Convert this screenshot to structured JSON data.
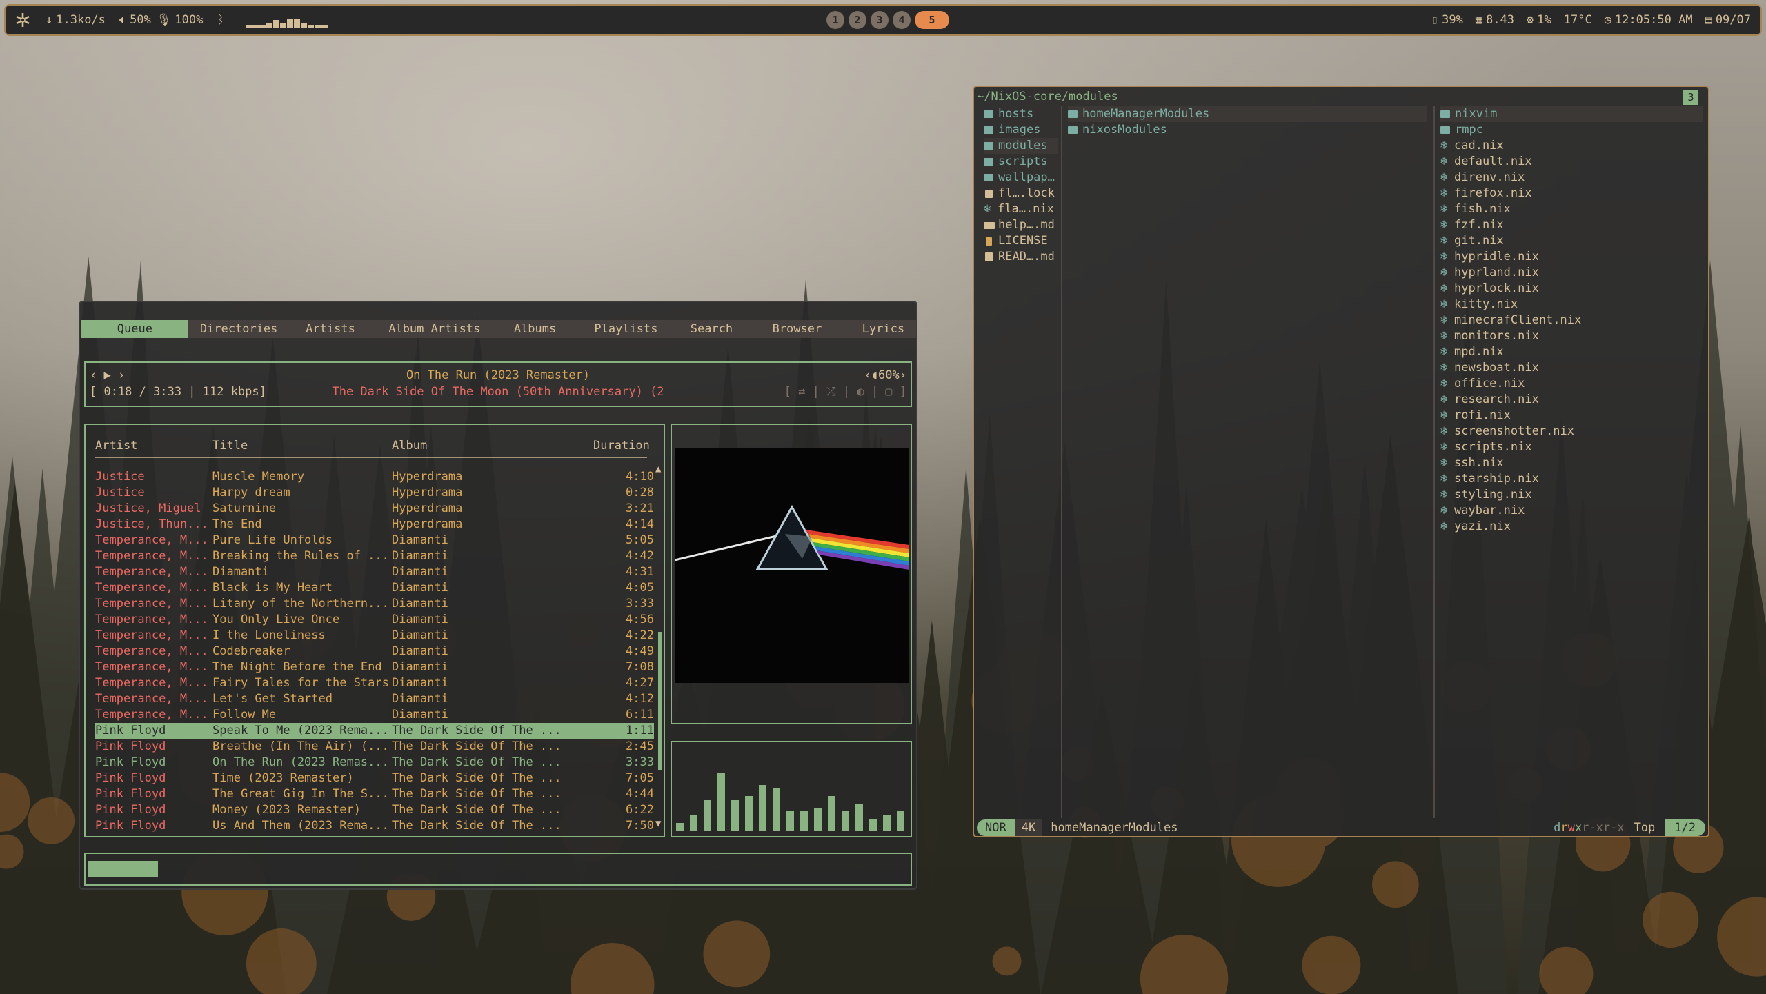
{
  "bar": {
    "net": "1.3ko/s",
    "volume": "50%",
    "mic": "100%",
    "workspaces": [
      "1",
      "2",
      "3",
      "4",
      "5"
    ],
    "active_workspace": "5",
    "battery": "39%",
    "memory": "8.43",
    "cpu": "1%",
    "temp": "17°C",
    "clock": "12:05:50 AM",
    "date": "09/07"
  },
  "ncmpcpp": {
    "tabs": [
      "Queue",
      "Directories",
      "Artists",
      "Album Artists",
      "Albums",
      "Playlists",
      "Search",
      "Browser",
      "Lyrics"
    ],
    "active_tab": "Queue",
    "controls": "‹ ▶ ›",
    "now_title": "On The Run (2023 Remaster)",
    "now_album": "The Dark Side Of The Moon (50th Anniversary) (2",
    "time": "[ 0:18 / 3:33 | 112 kbps]",
    "volume": "‹◖60%›",
    "flags": "[ ⇄ | ⤮ | ◐ | ▢ ]",
    "columns": {
      "artist": "Artist",
      "title": "Title",
      "album": "Album",
      "duration": "Duration"
    },
    "queue": [
      {
        "artist": "Justice",
        "title": "Muscle Memory",
        "album": "Hyperdrama",
        "duration": "4:10"
      },
      {
        "artist": "Justice",
        "title": "Harpy dream",
        "album": "Hyperdrama",
        "duration": "0:28"
      },
      {
        "artist": "Justice, Miguel",
        "title": "Saturnine",
        "album": "Hyperdrama",
        "duration": "3:21"
      },
      {
        "artist": "Justice, Thun...",
        "title": "The End",
        "album": "Hyperdrama",
        "duration": "4:14"
      },
      {
        "artist": "Temperance, M...",
        "title": "Pure Life Unfolds",
        "album": "Diamanti",
        "duration": "5:05"
      },
      {
        "artist": "Temperance, M...",
        "title": "Breaking the Rules of ...",
        "album": "Diamanti",
        "duration": "4:42"
      },
      {
        "artist": "Temperance, M...",
        "title": "Diamanti",
        "album": "Diamanti",
        "duration": "4:31"
      },
      {
        "artist": "Temperance, M...",
        "title": "Black is My Heart",
        "album": "Diamanti",
        "duration": "4:05"
      },
      {
        "artist": "Temperance, M...",
        "title": "Litany of the Northern...",
        "album": "Diamanti",
        "duration": "3:33"
      },
      {
        "artist": "Temperance, M...",
        "title": "You Only Live Once",
        "album": "Diamanti",
        "duration": "4:56"
      },
      {
        "artist": "Temperance, M...",
        "title": "I the Loneliness",
        "album": "Diamanti",
        "duration": "4:22"
      },
      {
        "artist": "Temperance, M...",
        "title": "Codebreaker",
        "album": "Diamanti",
        "duration": "4:49"
      },
      {
        "artist": "Temperance, M...",
        "title": "The Night Before the End",
        "album": "Diamanti",
        "duration": "7:08"
      },
      {
        "artist": "Temperance, M...",
        "title": "Fairy Tales for the Stars",
        "album": "Diamanti",
        "duration": "4:27"
      },
      {
        "artist": "Temperance, M...",
        "title": "Let's Get Started",
        "album": "Diamanti",
        "duration": "4:12"
      },
      {
        "artist": "Temperance, M...",
        "title": "Follow Me",
        "album": "Diamanti",
        "duration": "6:11"
      },
      {
        "artist": "Pink Floyd",
        "title": "Speak To Me (2023 Rema...",
        "album": "The Dark Side Of The ...",
        "duration": "1:11"
      },
      {
        "artist": "Pink Floyd",
        "title": "Breathe (In The Air) (...",
        "album": "The Dark Side Of The ...",
        "duration": "2:45"
      },
      {
        "artist": "Pink Floyd",
        "title": "On The Run (2023 Remas...",
        "album": "The Dark Side Of The ...",
        "duration": "3:33"
      },
      {
        "artist": "Pink Floyd",
        "title": "Time (2023 Remaster)",
        "album": "The Dark Side Of The ...",
        "duration": "7:05"
      },
      {
        "artist": "Pink Floyd",
        "title": "The Great Gig In The S...",
        "album": "The Dark Side Of The ...",
        "duration": "4:44"
      },
      {
        "artist": "Pink Floyd",
        "title": "Money (2023 Remaster)",
        "album": "The Dark Side Of The ...",
        "duration": "6:22"
      },
      {
        "artist": "Pink Floyd",
        "title": "Us And Them (2023 Rema...",
        "album": "The Dark Side Of The ...",
        "duration": "7:50"
      }
    ],
    "selected_index": 16,
    "playing_index": 18,
    "progress_fraction": 0.085,
    "visualizer_levels": [
      0.1,
      0.2,
      0.4,
      0.75,
      0.4,
      0.45,
      0.6,
      0.55,
      0.25,
      0.25,
      0.3,
      0.45,
      0.25,
      0.35,
      0.15,
      0.2,
      0.25
    ]
  },
  "yazi": {
    "path": "~/NixOS-core/modules",
    "tab": "3",
    "parent": [
      {
        "name": "hosts",
        "icon": "folder-icon",
        "dir": true
      },
      {
        "name": "images",
        "icon": "folder-icon",
        "dir": true
      },
      {
        "name": "modules",
        "icon": "folder-icon",
        "dir": true
      },
      {
        "name": "scripts",
        "icon": "folder-icon",
        "dir": true
      },
      {
        "name": "wallpap…",
        "icon": "folder-icon",
        "dir": true
      },
      {
        "name": "fl….lock",
        "icon": "lock-icon",
        "dir": false
      },
      {
        "name": "fla….nix",
        "icon": "nix-icon",
        "dir": false
      },
      {
        "name": "help….md",
        "icon": "markdown-icon",
        "dir": false
      },
      {
        "name": "LICENSE",
        "icon": "license-icon",
        "dir": false
      },
      {
        "name": "READ….md",
        "icon": "readme-icon",
        "dir": false
      }
    ],
    "parent_highlight": 2,
    "current": [
      {
        "name": "homeManagerModules",
        "icon": "folder-icon",
        "dir": true
      },
      {
        "name": "nixosModules",
        "icon": "folder-icon",
        "dir": true
      }
    ],
    "current_highlight": 0,
    "preview": [
      {
        "name": "nixvim",
        "icon": "folder-icon",
        "dir": true
      },
      {
        "name": "rmpc",
        "icon": "folder-icon",
        "dir": true
      },
      {
        "name": "cad.nix",
        "icon": "nix-icon",
        "dir": false
      },
      {
        "name": "default.nix",
        "icon": "nix-icon",
        "dir": false
      },
      {
        "name": "direnv.nix",
        "icon": "nix-icon",
        "dir": false
      },
      {
        "name": "firefox.nix",
        "icon": "nix-icon",
        "dir": false
      },
      {
        "name": "fish.nix",
        "icon": "nix-icon",
        "dir": false
      },
      {
        "name": "fzf.nix",
        "icon": "nix-icon",
        "dir": false
      },
      {
        "name": "git.nix",
        "icon": "nix-icon",
        "dir": false
      },
      {
        "name": "hypridle.nix",
        "icon": "nix-icon",
        "dir": false
      },
      {
        "name": "hyprland.nix",
        "icon": "nix-icon",
        "dir": false
      },
      {
        "name": "hyprlock.nix",
        "icon": "nix-icon",
        "dir": false
      },
      {
        "name": "kitty.nix",
        "icon": "nix-icon",
        "dir": false
      },
      {
        "name": "minecrafClient.nix",
        "icon": "nix-icon",
        "dir": false
      },
      {
        "name": "monitors.nix",
        "icon": "nix-icon",
        "dir": false
      },
      {
        "name": "mpd.nix",
        "icon": "nix-icon",
        "dir": false
      },
      {
        "name": "newsboat.nix",
        "icon": "nix-icon",
        "dir": false
      },
      {
        "name": "office.nix",
        "icon": "nix-icon",
        "dir": false
      },
      {
        "name": "research.nix",
        "icon": "nix-icon",
        "dir": false
      },
      {
        "name": "rofi.nix",
        "icon": "nix-icon",
        "dir": false
      },
      {
        "name": "screenshotter.nix",
        "icon": "nix-icon",
        "dir": false
      },
      {
        "name": "scripts.nix",
        "icon": "nix-icon",
        "dir": false
      },
      {
        "name": "ssh.nix",
        "icon": "nix-icon",
        "dir": false
      },
      {
        "name": "starship.nix",
        "icon": "nix-icon",
        "dir": false
      },
      {
        "name": "styling.nix",
        "icon": "nix-icon",
        "dir": false
      },
      {
        "name": "waybar.nix",
        "icon": "nix-icon",
        "dir": false
      },
      {
        "name": "yazi.nix",
        "icon": "nix-icon",
        "dir": false
      }
    ],
    "preview_highlight": 0,
    "status": {
      "mode": "NOR",
      "size": "4K",
      "name": "homeManagerModules",
      "perm_d": "d",
      "perm_r": "r",
      "perm_w": "w",
      "perm_x": "x",
      "perm_rest": "r-xr-x",
      "scroll": "Top",
      "position": "1/2"
    }
  },
  "colors": {
    "accent": "#89b482",
    "border": "#a88452",
    "red": "#ea6962",
    "yellow": "#d8a657",
    "fg": "#d4be98",
    "bg": "#282828"
  }
}
